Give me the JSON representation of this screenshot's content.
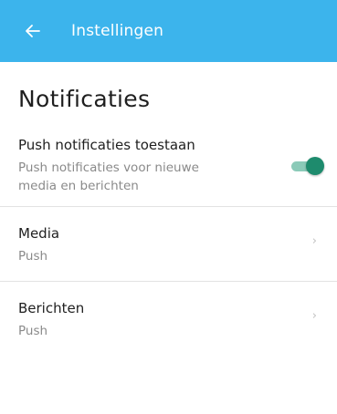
{
  "header": {
    "back_icon": "arrow-left-icon",
    "title": "Instellingen",
    "background_color": "#3cb4ec"
  },
  "notifications": {
    "heading": "Notificaties",
    "push_toggle": {
      "title": "Push notificaties toestaan",
      "subtitle_line1": "Push notificaties voor nieuwe",
      "subtitle_line2": "media en berichten",
      "enabled": true,
      "accent_color": "#1e8b6d"
    },
    "items": [
      {
        "title": "Media",
        "subtitle": "Push",
        "icon": "chevron-right-icon"
      },
      {
        "title": "Berichten",
        "subtitle": "Push",
        "icon": "chevron-right-icon"
      }
    ]
  }
}
